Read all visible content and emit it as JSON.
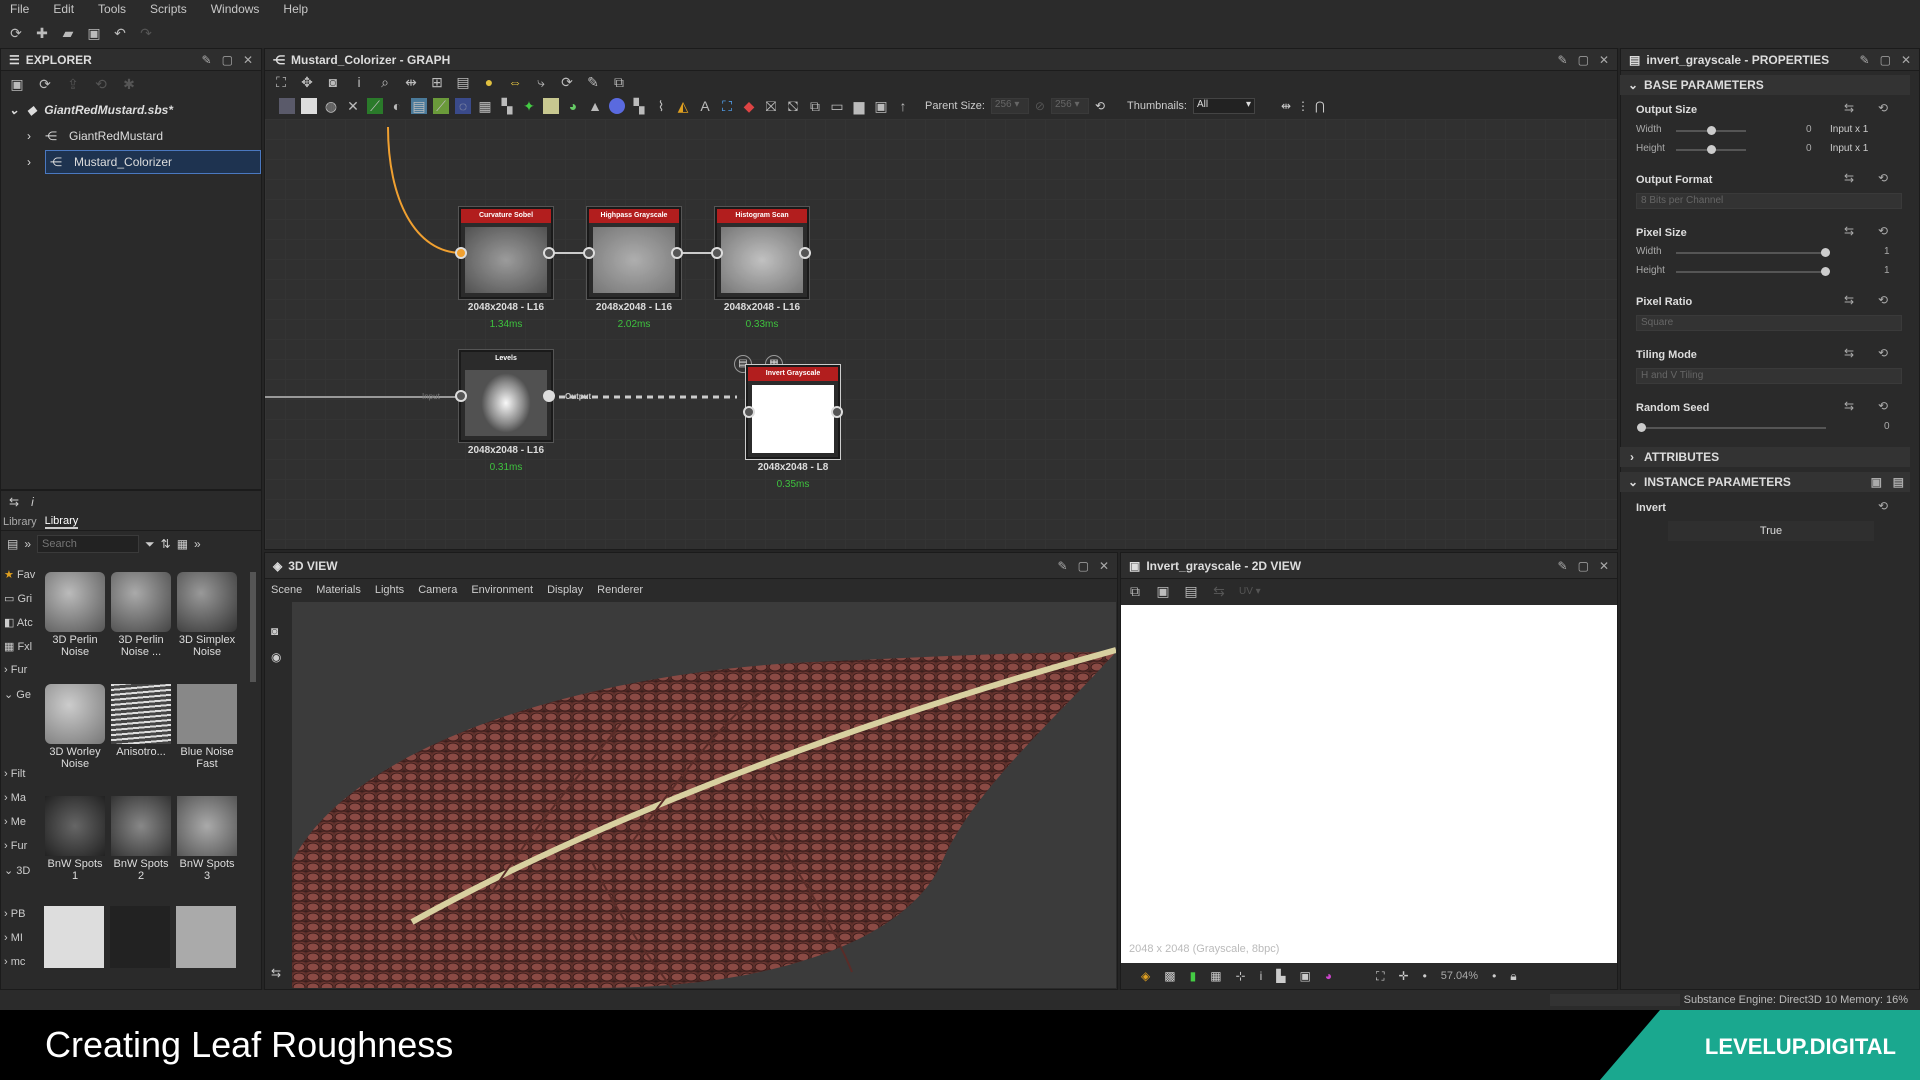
{
  "menu": [
    "File",
    "Edit",
    "Tools",
    "Scripts",
    "Windows",
    "Help"
  ],
  "explorer": {
    "title": "EXPLORER",
    "package": "GiantRedMustard.sbs*",
    "items": [
      "GiantRedMustard",
      "Mustard_Colorizer"
    ]
  },
  "library": {
    "tabs": [
      "Library",
      "Library"
    ],
    "search_placeholder": "Search",
    "categories": [
      "Fav",
      "Gri",
      "Atc",
      "Fxl",
      "Fur",
      "Ge",
      "Filt",
      "Ma",
      "Me",
      "Fur",
      "3D",
      "PB",
      "MI",
      "mc"
    ],
    "tiles": [
      {
        "label": "3D Perlin Noise"
      },
      {
        "label": "3D Perlin Noise ..."
      },
      {
        "label": "3D Simplex Noise"
      },
      {
        "label": "3D Worley Noise"
      },
      {
        "label": "Anisotro..."
      },
      {
        "label": "Blue Noise Fast"
      },
      {
        "label": "BnW Spots 1"
      },
      {
        "label": "BnW Spots 2"
      },
      {
        "label": "BnW Spots 3"
      }
    ]
  },
  "graph": {
    "title": "Mustard_Colorizer - GRAPH",
    "parent_size_label": "Parent Size:",
    "parent_size_value": "256",
    "size_value_2": "256",
    "thumbnails_label": "Thumbnails:",
    "thumbnails_value": "All",
    "nodes": [
      {
        "name": "Curvature Sobel",
        "res": "2048x2048 - L16",
        "time": "1.34ms"
      },
      {
        "name": "Highpass Grayscale",
        "res": "2048x2048 - L16",
        "time": "2.02ms"
      },
      {
        "name": "Histogram Scan",
        "res": "2048x2048 - L16",
        "time": "0.33ms"
      },
      {
        "name": "Levels",
        "res": "2048x2048 - L16",
        "time": "0.31ms"
      },
      {
        "name": "Invert Grayscale",
        "res": "2048x2048 - L8",
        "time": "0.35ms"
      }
    ],
    "output_port_label": "Output",
    "input_port_label": "Input"
  },
  "view3d": {
    "title": "3D VIEW",
    "menu": [
      "Scene",
      "Materials",
      "Lights",
      "Camera",
      "Environment",
      "Display",
      "Renderer"
    ]
  },
  "view2d": {
    "title": "Invert_grayscale - 2D VIEW",
    "uv_label": "UV",
    "status": "2048 x 2048 (Grayscale, 8bpc)",
    "zoom": "57.04%"
  },
  "properties": {
    "title": "invert_grayscale - PROPERTIES",
    "base_section": "BASE PARAMETERS",
    "output_size": "Output Size",
    "width_label": "Width",
    "height_label": "Height",
    "output_width_value": "0",
    "output_height_value": "0",
    "output_width_rel": "Input x 1",
    "output_height_rel": "Input x 1",
    "output_format": "Output Format",
    "output_format_value": "8 Bits per Channel",
    "pixel_size": "Pixel Size",
    "pixel_width_value": "1",
    "pixel_height_value": "1",
    "pixel_ratio": "Pixel Ratio",
    "pixel_ratio_value": "Square",
    "tiling_mode": "Tiling Mode",
    "tiling_mode_value": "H and V Tiling",
    "random_seed": "Random Seed",
    "random_seed_value": "0",
    "attributes_section": "ATTRIBUTES",
    "instance_section": "INSTANCE PARAMETERS",
    "invert_label": "Invert",
    "invert_value": "True"
  },
  "statusbar": {
    "engine": "Substance Engine: Direct3D 10  Memory: 16%"
  },
  "banner": {
    "title": "Creating Leaf Roughness",
    "brand": "LEVELUP.DIGITAL"
  },
  "colors": {
    "node_header": "#b21e1e",
    "timing_green": "#3ec23e",
    "connection_orange": "#f0a030",
    "brand_teal": "#1aa88f"
  }
}
